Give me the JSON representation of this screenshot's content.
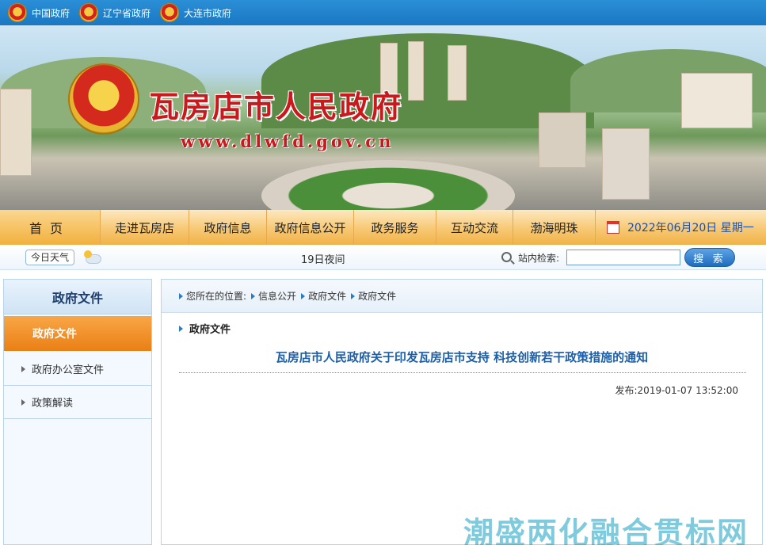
{
  "topbar": {
    "links": [
      {
        "label": "中国政府"
      },
      {
        "label": "辽宁省政府"
      },
      {
        "label": "大连市政府"
      }
    ]
  },
  "banner": {
    "title": "瓦房店市人民政府",
    "url": "www.dlwfd.gov.cn"
  },
  "nav": {
    "items": [
      "首页",
      "走进瓦房店",
      "政府信息",
      "政府信息公开",
      "政务服务",
      "互动交流",
      "渤海明珠"
    ],
    "date": "2022年06月20日 星期一"
  },
  "subbar": {
    "weather_button": "今日天气",
    "weather_text": "19日夜间",
    "search_label": "站内检索:",
    "search_value": "",
    "search_button": "搜 索"
  },
  "sidebar": {
    "title": "政府文件",
    "active_item": "政府文件",
    "items": [
      "政府办公室文件",
      "政策解读"
    ]
  },
  "main": {
    "breadcrumb_prefix": "您所在的位置:",
    "breadcrumb": [
      "信息公开",
      "政府文件",
      "政府文件"
    ],
    "section_title": "政府文件",
    "article_title": "瓦房店市人民政府关于印发瓦房店市支持 科技创新若干政策措施的通知",
    "published": "发布:2019-01-07 13:52:00"
  },
  "watermark": "潮盛两化融合贯标网",
  "colors": {
    "accent_blue": "#1b77c2",
    "title_red": "#c8191d",
    "nav_orange": "#f0b247",
    "active_orange": "#ea7f14",
    "link_blue": "#1d5ea8"
  }
}
